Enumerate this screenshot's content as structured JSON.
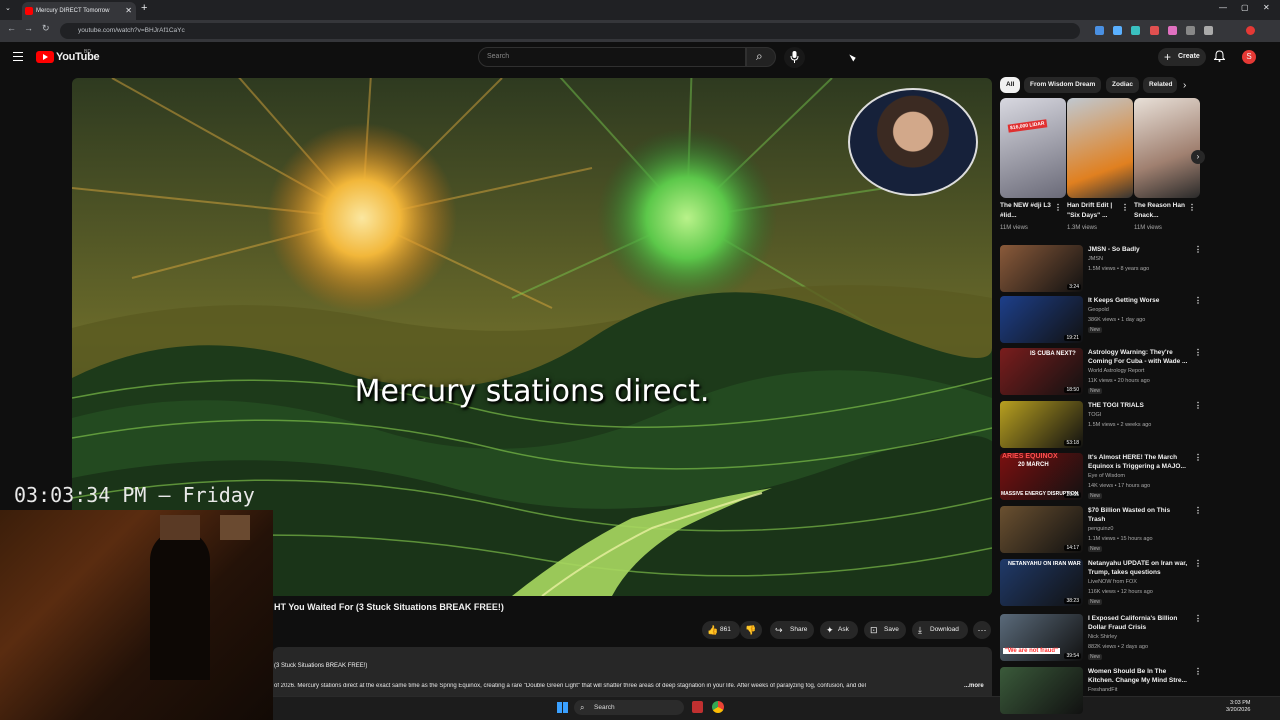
{
  "browser": {
    "tab_title": "Mercury DIRECT Tomorrow",
    "tab_close": "✕",
    "new_tab": "+",
    "url": "youtube.com/watch?v=BHJrAf1CaYc",
    "back": "←",
    "forward": "→",
    "reload": "↻",
    "minimize": "—",
    "maximize": "▢",
    "close": "✕"
  },
  "header": {
    "logo_text": "YouTube",
    "country_code": "BD",
    "search_placeholder": "Search",
    "search_icon": "⌕",
    "mic_icon": "🎤",
    "create_label": "Create",
    "create_plus": "+",
    "bell_icon": "🔔",
    "avatar_letter": "S"
  },
  "video": {
    "caption": "Mercury stations direct.",
    "title_visible": "HT You Waited For (3 Stuck Situations BREAK FREE!)",
    "desc_line1": "(3 Stuck Situations BREAK FREE!)",
    "desc_line2": "of 2026. Mercury stations direct at the exact same time as the Spring Equinox, creating a rare \"Double Green Light\" that will shatter three areas of deep stagnation in your life. After weeks of paralyzing fog, confusion, and del",
    "desc_more": "...more",
    "actions": {
      "likes": "861",
      "share": "Share",
      "ask": "Ask",
      "save": "Save",
      "download": "Download",
      "more": "⋯"
    }
  },
  "overlay": {
    "clock": "03:03:34 PM — Friday"
  },
  "chips": [
    "All",
    "From Wisdom Dream",
    "Zodiac",
    "Related"
  ],
  "chip_next": "›",
  "shorts": [
    {
      "title": "The NEW #dji L3 #lid...",
      "views": "11M views",
      "badge": "$16,000 LIDAR"
    },
    {
      "title": "Han Drift Edit | \"Six Days\" ...",
      "views": "1.3M views"
    },
    {
      "title": "The Reason Han Snack...",
      "views": "11M views"
    }
  ],
  "recommendations": [
    {
      "title1": "JMSN - So Badly",
      "title2": "",
      "channel": "JMSN",
      "meta": "1.5M views • 8 years ago",
      "duration": "3:24",
      "badge": "",
      "color": "#8a5a3a"
    },
    {
      "title1": "It Keeps Getting Worse",
      "title2": "",
      "channel": "Geopold",
      "meta": "386K views • 1 day ago",
      "duration": "19:21",
      "badge": "New",
      "color": "#1d3f8a"
    },
    {
      "title1": "Astrology Warning: They're",
      "title2": "Coming For Cuba - with Wade ...",
      "channel": "World Astrology Report",
      "meta": "11K views • 20 hours ago",
      "duration": "18:50",
      "badge": "New",
      "color": "#7a1d1d"
    },
    {
      "title1": "THE TOGI TRIALS",
      "title2": "",
      "channel": "TOGI",
      "meta": "1.5M views • 2 weeks ago",
      "duration": "53:18",
      "badge": "",
      "color": "#b8a020"
    },
    {
      "title1": "It's Almost HERE! The March",
      "title2": "Equinox is Triggering a MAJO...",
      "channel": "Eye of Wisdom",
      "meta": "14K views • 17 hours ago",
      "duration": "20:55",
      "badge": "New",
      "color": "#7a1010"
    },
    {
      "title1": "$70 Billion Wasted on This",
      "title2": "Trash",
      "channel": "penguinz0",
      "meta": "1.1M views • 15 hours ago",
      "duration": "14:17",
      "badge": "New",
      "color": "#6a5030"
    },
    {
      "title1": "Netanyahu UPDATE on Iran war,",
      "title2": "Trump, takes questions",
      "channel": "LiveNOW from FOX",
      "meta": "116K views • 12 hours ago",
      "duration": "38:23",
      "badge": "New",
      "color": "#203a6a"
    },
    {
      "title1": "I Exposed California's Billion",
      "title2": "Dollar Fraud Crisis",
      "channel": "Nick Shirley",
      "meta": "882K views • 2 days ago",
      "duration": "39:54",
      "badge": "New",
      "color": "#5a6a7a"
    },
    {
      "title1": "Women Should Be In The",
      "title2": "Kitchen. Change My Mind Stre...",
      "channel": "FreshandFit",
      "meta": "",
      "duration": "",
      "badge": "",
      "color": "#3a5a3a"
    }
  ],
  "rec_more_icon": "⋮",
  "short_more_icon": "⋮",
  "thumb_labels": {
    "rec3": "IS CUBA NEXT?",
    "rec5_top": "ARIES EQUINOX",
    "rec5_mid": "20 MARCH",
    "rec5_bottom": "MASSIVE ENERGY DISRUPTION",
    "rec7": "NETANYAHU ON IRAN WAR",
    "rec8": "\"We are not fraud\""
  },
  "taskbar": {
    "search": "Search",
    "time": "3:03 PM",
    "date": "3/20/2026"
  }
}
